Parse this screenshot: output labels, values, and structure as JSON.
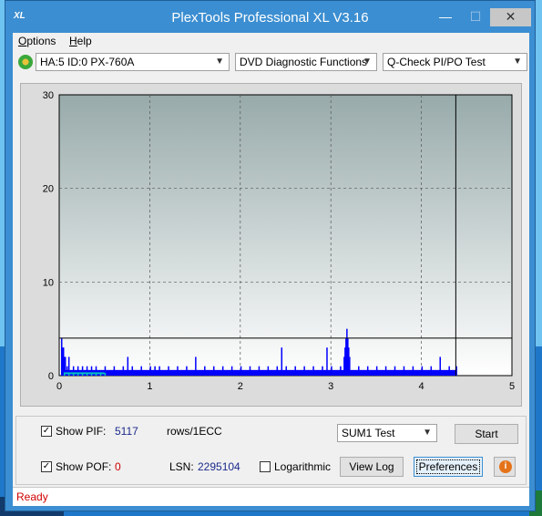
{
  "window": {
    "title": "PlexTools Professional XL V3.16",
    "app_icon_text": "XL",
    "min_glyph": "—",
    "max_glyph": "☐",
    "close_glyph": "✕"
  },
  "menu": {
    "options": "Options",
    "help": "Help"
  },
  "toolbar": {
    "device": "HA:5 ID:0  PX-760A",
    "function": "DVD Diagnostic Functions",
    "test": "Q-Check PI/PO Test"
  },
  "chart_data": {
    "type": "bar",
    "title": "",
    "xlabel": "",
    "ylabel": "",
    "xlim": [
      0,
      5
    ],
    "ylim": [
      0,
      30
    ],
    "x_ticks": [
      "0",
      "1",
      "2",
      "3",
      "4",
      "5"
    ],
    "y_ticks": [
      "0",
      "10",
      "20",
      "30"
    ],
    "grid": true,
    "marker_x": 4.38,
    "threshold_y": 4,
    "series": [
      {
        "color": "#0000ff",
        "x": [
          0.02,
          0.03,
          0.04,
          0.05,
          0.06,
          0.08,
          0.1,
          0.15,
          0.2,
          0.25,
          0.3,
          0.35,
          0.4,
          0.5,
          0.6,
          0.7,
          0.75,
          0.8,
          0.9,
          1.0,
          1.05,
          1.1,
          1.2,
          1.3,
          1.4,
          1.5,
          1.6,
          1.7,
          1.8,
          1.9,
          2.0,
          2.1,
          2.2,
          2.3,
          2.4,
          2.45,
          2.5,
          2.6,
          2.7,
          2.8,
          2.9,
          2.95,
          3.0,
          3.1,
          3.14,
          3.15,
          3.16,
          3.17,
          3.18,
          3.19,
          3.2,
          3.3,
          3.4,
          3.5,
          3.6,
          3.7,
          3.8,
          3.9,
          4.0,
          4.1,
          4.2,
          4.3,
          4.38
        ],
        "values": [
          4,
          3,
          3,
          2,
          2,
          1,
          2,
          1,
          1,
          1,
          1,
          1,
          1,
          1,
          1,
          1,
          2,
          1,
          1,
          1,
          1,
          1,
          1,
          1,
          1,
          2,
          1,
          1,
          1,
          1,
          1,
          1,
          1,
          1,
          1,
          3,
          1,
          1,
          1,
          1,
          1,
          3,
          1,
          1,
          2,
          3,
          4,
          5,
          4,
          3,
          2,
          1,
          1,
          1,
          1,
          1,
          1,
          1,
          1,
          1,
          2,
          1,
          1
        ]
      },
      {
        "color": "#00c0c0",
        "x": [
          0.05,
          0.1,
          0.15,
          0.2,
          0.25,
          0.3,
          0.35,
          0.4,
          0.45,
          0.5
        ],
        "values": [
          0.3,
          0.3,
          0.3,
          0.3,
          0.3,
          0.3,
          0.3,
          0.3,
          0.3,
          0.3
        ]
      }
    ]
  },
  "controls": {
    "show_pif_label": "Show PIF:",
    "pif_value": "5117",
    "rows_label": "rows/1ECC",
    "show_pof_label": "Show POF:",
    "pof_value": "0",
    "lsn_label": "LSN:",
    "lsn_value": "2295104",
    "log_label": "Logarithmic",
    "test_select": "SUM1 Test",
    "start": "Start",
    "view_log": "View Log",
    "preferences": "Preferences",
    "check_glyph": "✓",
    "info_glyph": "i"
  },
  "status": {
    "text": "Ready"
  }
}
